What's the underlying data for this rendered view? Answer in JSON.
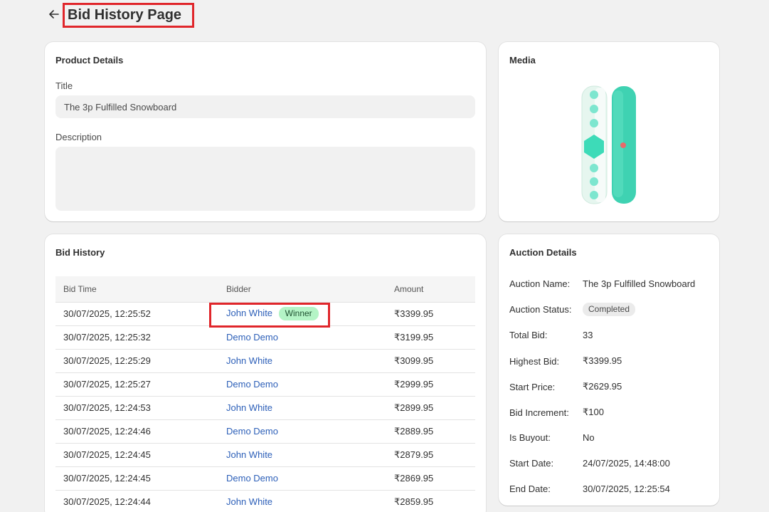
{
  "page": {
    "title": "Bid History Page"
  },
  "product": {
    "card_title": "Product Details",
    "title_label": "Title",
    "title_value": "The 3p Fulfilled Snowboard",
    "description_label": "Description",
    "description_value": ""
  },
  "media": {
    "card_title": "Media",
    "image": "snowboard-product-image"
  },
  "history": {
    "card_title": "Bid History",
    "columns": [
      "Bid Time",
      "Bidder",
      "Amount"
    ],
    "winner_label": "Winner",
    "rows": [
      {
        "time": "30/07/2025, 12:25:52",
        "bidder": "John White",
        "amount": "₹3399.95"
      },
      {
        "time": "30/07/2025, 12:25:32",
        "bidder": "Demo Demo",
        "amount": "₹3199.95"
      },
      {
        "time": "30/07/2025, 12:25:29",
        "bidder": "John White",
        "amount": "₹3099.95"
      },
      {
        "time": "30/07/2025, 12:25:27",
        "bidder": "Demo Demo",
        "amount": "₹2999.95"
      },
      {
        "time": "30/07/2025, 12:24:53",
        "bidder": "John White",
        "amount": "₹2899.95"
      },
      {
        "time": "30/07/2025, 12:24:46",
        "bidder": "Demo Demo",
        "amount": "₹2889.95"
      },
      {
        "time": "30/07/2025, 12:24:45",
        "bidder": "John White",
        "amount": "₹2879.95"
      },
      {
        "time": "30/07/2025, 12:24:45",
        "bidder": "Demo Demo",
        "amount": "₹2869.95"
      },
      {
        "time": "30/07/2025, 12:24:44",
        "bidder": "John White",
        "amount": "₹2859.95"
      }
    ]
  },
  "auction": {
    "card_title": "Auction Details",
    "name_label": "Auction Name:",
    "name_value": "The 3p Fulfilled Snowboard",
    "status_label": "Auction Status:",
    "status_value": "Completed",
    "total_bid_label": "Total Bid:",
    "total_bid_value": "33",
    "highest_bid_label": "Highest Bid:",
    "highest_bid_value": "₹3399.95",
    "start_price_label": "Start Price:",
    "start_price_value": "₹2629.95",
    "bid_increment_label": "Bid Increment:",
    "bid_increment_value": "₹100",
    "is_buyout_label": "Is Buyout:",
    "is_buyout_value": "No",
    "start_date_label": "Start Date:",
    "start_date_value": "24/07/2025, 14:48:00",
    "end_date_label": "End Date:",
    "end_date_value": "30/07/2025, 12:25:54"
  },
  "colors": {
    "background": "#f1f1f1",
    "card": "#ffffff",
    "link": "#2c5fb8",
    "highlight": "#e0262b",
    "winner_badge": "#b4f4c6"
  }
}
